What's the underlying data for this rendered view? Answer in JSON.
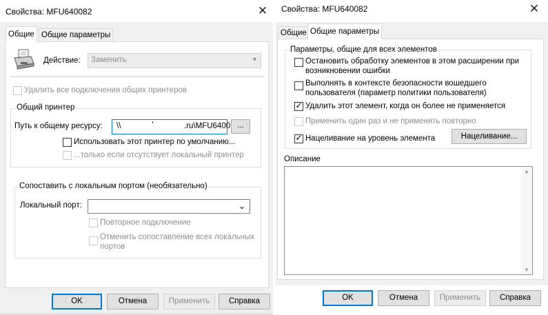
{
  "left": {
    "title": "Свойства: MFU640082",
    "close_glyph": "✕",
    "tabs": [
      "Общие",
      "Общие параметры"
    ],
    "action_label": "Действие:",
    "action_value": "Заменить",
    "delete_all_label": "Удалить все подключения общих принтеров",
    "shared_group_title": "Общий принтер",
    "share_path_label": "Путь к общему ресурсу:",
    "share_path_prefix": "\\\\",
    "share_path_suffix": ".ru\\MFU6400",
    "browse_label": "...",
    "default_printer_label": "Использовать этот принтер по умолчанию...",
    "only_if_label": "...только если отсутствует локальный принтер",
    "map_group_title": "Сопоставить с локальным портом (необязательно)",
    "local_port_label": "Локальный порт:",
    "local_port_value": "",
    "reconnect_label": "Повторное подключение",
    "unmap_all_label": "Отменить сопоставление всех локальных портов",
    "buttons": {
      "ok": "OK",
      "cancel": "Отмена",
      "apply": "Применить",
      "help": "Справка"
    }
  },
  "right": {
    "title": "Свойства: MFU640082",
    "close_glyph": "✕",
    "tabs": [
      "Общие",
      "Общие параметры"
    ],
    "params_group_title": "Параметры, общие для всех элементов",
    "opt_stop": "Остановить обработку элементов в этом расширении при возникновении ошибки",
    "opt_user_context": "Выполнять в контексте безопасности вошедшего пользователя (параметр политики пользователя)",
    "opt_remove": "Удалить этот элемент, когда он более не применяется",
    "opt_apply_once": "Применить один раз и не применять повторно",
    "opt_targeting": "Нацеливание на уровень элемента",
    "targeting_button": "Нацеливание...",
    "description_label": "Описание",
    "description_value": "",
    "buttons": {
      "ok": "OK",
      "cancel": "Отмена",
      "apply": "Применить",
      "help": "Справка"
    }
  }
}
